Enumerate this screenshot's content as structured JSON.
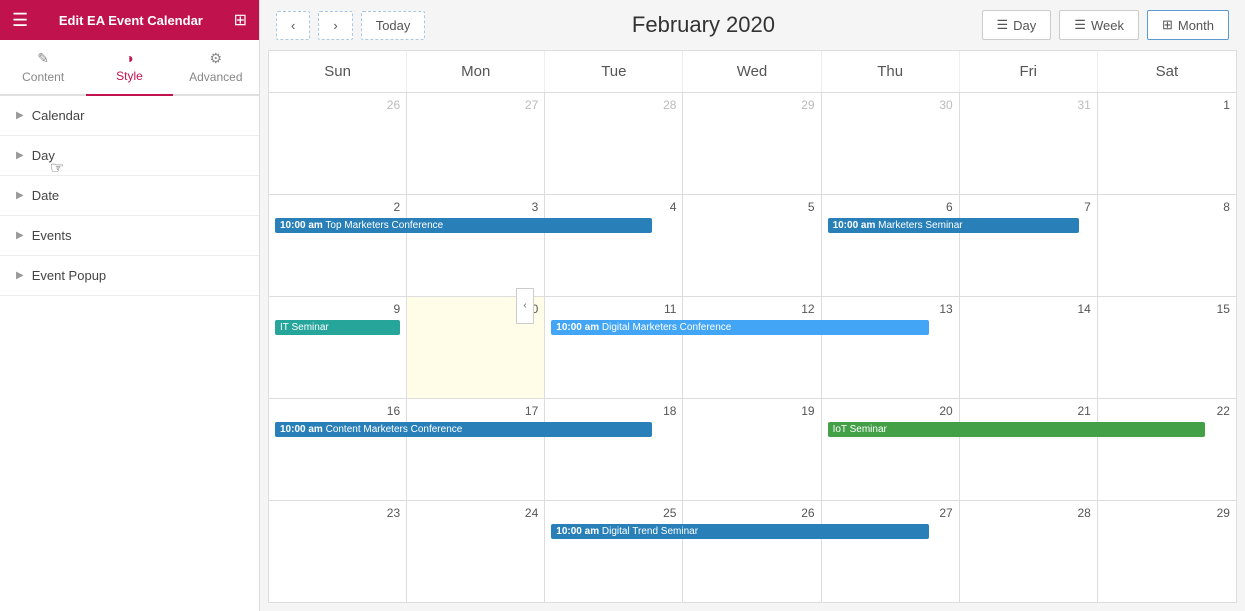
{
  "sidebar": {
    "header_title": "Edit EA Event Calendar",
    "tabs": [
      {
        "label": "Content",
        "icon": "✎",
        "active": false
      },
      {
        "label": "Style",
        "icon": "◑",
        "active": true
      },
      {
        "label": "Advanced",
        "icon": "⚙",
        "active": false
      }
    ],
    "sections": [
      {
        "label": "Calendar"
      },
      {
        "label": "Day"
      },
      {
        "label": "Date"
      },
      {
        "label": "Events"
      },
      {
        "label": "Event Popup"
      }
    ]
  },
  "topnav": {
    "prev_label": "‹",
    "next_label": "›",
    "today_label": "Today",
    "title": "February 2020",
    "day_label": "Day",
    "week_label": "Week",
    "month_label": "Month",
    "month_tab_label": "# Month"
  },
  "calendar": {
    "headers": [
      "Sun",
      "Mon",
      "Tue",
      "Wed",
      "Thu",
      "Fri",
      "Sat"
    ],
    "rows": [
      {
        "cells": [
          {
            "date": "26",
            "current": false,
            "today": false,
            "events": []
          },
          {
            "date": "27",
            "current": false,
            "today": false,
            "events": []
          },
          {
            "date": "28",
            "current": false,
            "today": false,
            "events": []
          },
          {
            "date": "29",
            "current": false,
            "today": false,
            "events": []
          },
          {
            "date": "30",
            "current": false,
            "today": false,
            "events": []
          },
          {
            "date": "31",
            "current": false,
            "today": false,
            "events": []
          },
          {
            "date": "1",
            "current": true,
            "today": false,
            "events": []
          }
        ]
      },
      {
        "cells": [
          {
            "date": "2",
            "current": true,
            "today": false,
            "events": [
              {
                "time": "10:00 am",
                "label": "Top Marketers Conference",
                "color": "blue",
                "span": 3
              }
            ]
          },
          {
            "date": "3",
            "current": true,
            "today": false,
            "events": []
          },
          {
            "date": "4",
            "current": true,
            "today": false,
            "events": []
          },
          {
            "date": "5",
            "current": true,
            "today": false,
            "events": []
          },
          {
            "date": "6",
            "current": true,
            "today": false,
            "events": [
              {
                "time": "10:00 am",
                "label": "Marketers Seminar",
                "color": "blue",
                "span": 2
              }
            ]
          },
          {
            "date": "7",
            "current": true,
            "today": false,
            "events": []
          },
          {
            "date": "8",
            "current": true,
            "today": false,
            "events": []
          }
        ]
      },
      {
        "cells": [
          {
            "date": "9",
            "current": true,
            "today": false,
            "events": [
              {
                "time": "",
                "label": "IT Seminar",
                "color": "teal",
                "span": 1
              }
            ]
          },
          {
            "date": "10",
            "current": true,
            "today": true,
            "events": []
          },
          {
            "date": "11",
            "current": true,
            "today": false,
            "events": [
              {
                "time": "10:00 am",
                "label": "Digital Marketers Conference",
                "color": "light-blue",
                "span": 3
              }
            ]
          },
          {
            "date": "12",
            "current": true,
            "today": false,
            "events": []
          },
          {
            "date": "13",
            "current": true,
            "today": false,
            "events": []
          },
          {
            "date": "14",
            "current": true,
            "today": false,
            "events": []
          },
          {
            "date": "15",
            "current": true,
            "today": false,
            "events": []
          }
        ]
      },
      {
        "cells": [
          {
            "date": "16",
            "current": true,
            "today": false,
            "events": [
              {
                "time": "10:00 am",
                "label": "Content Marketers Conference",
                "color": "blue",
                "span": 3
              }
            ]
          },
          {
            "date": "17",
            "current": true,
            "today": false,
            "events": []
          },
          {
            "date": "18",
            "current": true,
            "today": false,
            "events": []
          },
          {
            "date": "19",
            "current": true,
            "today": false,
            "events": []
          },
          {
            "date": "20",
            "current": true,
            "today": false,
            "events": [
              {
                "time": "",
                "label": "IoT Seminar",
                "color": "green",
                "span": 3
              }
            ]
          },
          {
            "date": "21",
            "current": true,
            "today": false,
            "events": []
          },
          {
            "date": "22",
            "current": true,
            "today": false,
            "events": []
          }
        ]
      },
      {
        "cells": [
          {
            "date": "23",
            "current": true,
            "today": false,
            "events": []
          },
          {
            "date": "24",
            "current": true,
            "today": false,
            "events": []
          },
          {
            "date": "25",
            "current": true,
            "today": false,
            "events": [
              {
                "time": "10:00 am",
                "label": "Digital Trend Seminar",
                "color": "blue",
                "span": 3
              }
            ]
          },
          {
            "date": "26",
            "current": true,
            "today": false,
            "events": []
          },
          {
            "date": "27",
            "current": true,
            "today": false,
            "events": []
          },
          {
            "date": "28",
            "current": true,
            "today": false,
            "events": []
          },
          {
            "date": "29",
            "current": true,
            "today": false,
            "events": []
          }
        ]
      }
    ]
  }
}
